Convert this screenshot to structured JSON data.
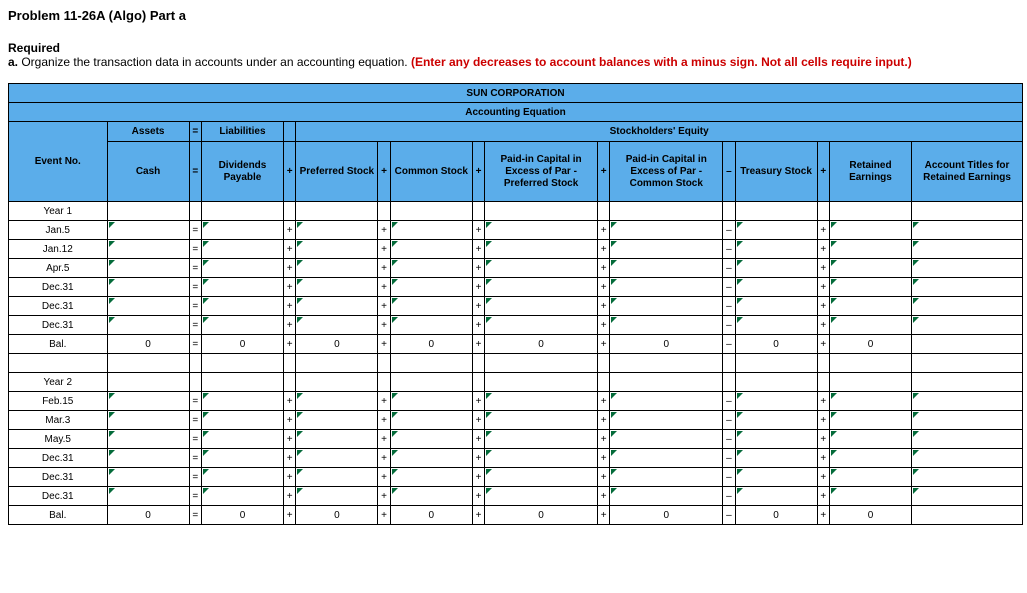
{
  "title": "Problem 11-26A (Algo) Part a",
  "required_head": "Required",
  "required_text_a": "a. ",
  "required_text_b": "Organize the transaction data in accounts under an accounting equation. ",
  "required_text_c": "(Enter any decreases to account balances with a minus sign. Not all cells require input.)",
  "corp": "SUN CORPORATION",
  "subtitle": "Accounting Equation",
  "h_assets": "Assets",
  "h_liab": "Liabilities",
  "h_se": "Stockholders' Equity",
  "h_event": "Event No.",
  "h_cash": "Cash",
  "h_div": "Dividends Payable",
  "h_pref": "Preferred Stock",
  "h_common": "Common Stock",
  "h_pic_pref": "Paid-in Capital in Excess of Par - Preferred Stock",
  "h_pic_com": "Paid-in Capital in Excess of Par - Common Stock",
  "h_treas": "Treasury Stock",
  "h_re": "Retained Earnings",
  "h_titles": "Account Titles for Retained Earnings",
  "year1": "Year 1",
  "year2": "Year 2",
  "rows_y1": [
    "Jan.5",
    "Jan.12",
    "Apr.5",
    "Dec.31",
    "Dec.31",
    "Dec.31"
  ],
  "rows_y2": [
    "Feb.15",
    "Mar.3",
    "May.5",
    "Dec.31",
    "Dec.31",
    "Dec.31"
  ],
  "bal": "Bal.",
  "zero": "0",
  "eq": "=",
  "plus": "+",
  "minus": "–"
}
